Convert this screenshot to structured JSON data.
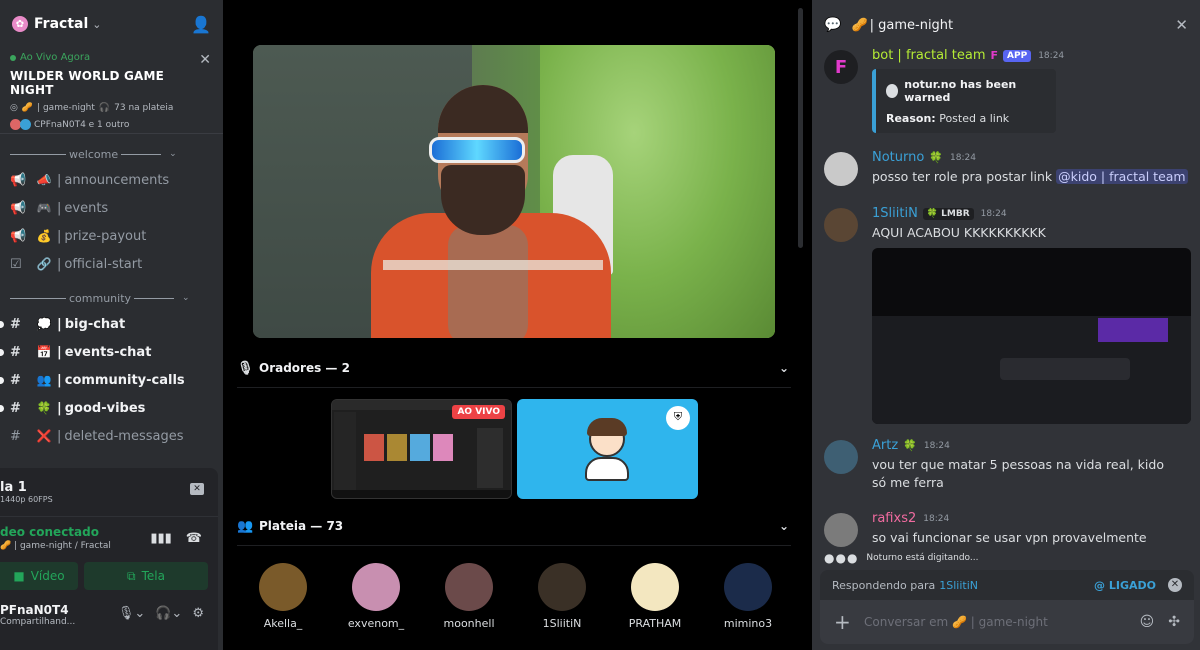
{
  "server": {
    "name": "Fractal"
  },
  "live": {
    "status": "Ao Vivo Agora",
    "title": "WILDER WORLD GAME NIGHT",
    "channel": "| game-night",
    "audience": "73 na plateia",
    "users": "CPFnaN0T4 e 1 outro"
  },
  "categories": {
    "welcome": "welcome",
    "community": "community"
  },
  "channels": [
    {
      "emoji": "📣",
      "name": "announcements",
      "unread": false,
      "icon": "megaphone-icon"
    },
    {
      "emoji": "🎮",
      "name": "events",
      "unread": false,
      "icon": "megaphone-icon"
    },
    {
      "emoji": "💰",
      "name": "prize-payout",
      "unread": false,
      "icon": "megaphone-icon"
    },
    {
      "emoji": "🔗",
      "name": "official-start",
      "unread": false,
      "icon": "rules-icon"
    },
    {
      "emoji": "💭",
      "name": "big-chat",
      "unread": true,
      "icon": "hash-icon"
    },
    {
      "emoji": "📅",
      "name": "events-chat",
      "unread": true,
      "icon": "hash-icon"
    },
    {
      "emoji": "👥",
      "name": "community-calls",
      "unread": true,
      "icon": "hash-icon"
    },
    {
      "emoji": "🍀",
      "name": "good-vibes",
      "unread": true,
      "icon": "hash-icon"
    },
    {
      "emoji": "❌",
      "name": "deleted-messages",
      "unread": false,
      "icon": "hash-icon"
    }
  ],
  "stream_panel": {
    "title": "la 1",
    "sub": "1440p 60FPS",
    "voice_title": "deo conectado",
    "voice_sub": "| game-night / Fractal",
    "video_btn": "Vídeo",
    "screen_btn": "Tela",
    "user": "PFnaN0T4",
    "user_status": "Compartilhand..."
  },
  "stage": {
    "speakers_label": "Oradores — 2",
    "audience_label": "Plateia — 73",
    "live_badge": "AO VIVO",
    "audience": [
      {
        "name": "Akella_",
        "color": "#7a5a2a"
      },
      {
        "name": "exvenom_",
        "color": "#c88fb0"
      },
      {
        "name": "moonhell",
        "color": "#6b4a4a"
      },
      {
        "name": "1SliitiN",
        "color": "#3a3026"
      },
      {
        "name": "PRATHAM",
        "color": "#f3e7c0"
      },
      {
        "name": "mimino3",
        "color": "#1b2b4a"
      }
    ]
  },
  "chat": {
    "channel": "| game-night",
    "messages": [
      {
        "author": "bot | fractal team",
        "badge": "APP",
        "tag": "F",
        "time": "18:24",
        "color": "#b5ec35"
      },
      {
        "author": "Noturno",
        "time": "18:24",
        "color": "#3aa0d6",
        "text": "posso ter role pra postar link ",
        "mention": "@kido | fractal team"
      },
      {
        "author": "1SliitiN",
        "role": "LMBR",
        "time": "18:24",
        "color": "#3aa0d6",
        "text": "AQUI ACABOU KKKKKKKKKK"
      },
      {
        "author": "Artz",
        "time": "18:24",
        "color": "#3aa0d6",
        "text": "vou ter que matar 5 pessoas na vida real, kido só me ferra"
      },
      {
        "author": "rafixs2",
        "time": "18:24",
        "color": "#f16ba0",
        "text": "so vai funcionar se usar vpn provavelmente"
      }
    ],
    "embed": {
      "title": "notur.no has been warned",
      "reason_label": "Reason:",
      "reason": "Posted a link"
    },
    "typing": "Noturno está digitando...",
    "reply": {
      "prefix": "Respondendo para",
      "name": "1SliitiN",
      "ping": "@ LIGADO"
    },
    "composer_placeholder": "Conversar em 🥜 | game-night"
  }
}
